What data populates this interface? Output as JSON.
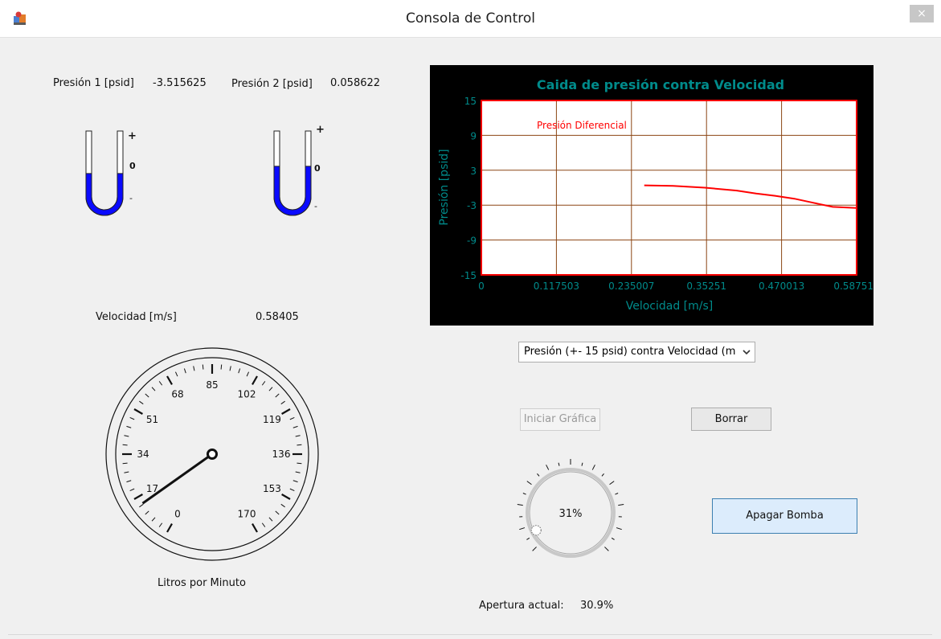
{
  "window": {
    "title": "Consola de Control",
    "close_label": "×"
  },
  "pressure1": {
    "label": "Presión 1 [psid]",
    "value": "-3.515625",
    "plus": "+",
    "zero": "0",
    "minus": "-",
    "level": -0.2344
  },
  "pressure2": {
    "label": "Presión 2 [psid]",
    "value": "0.058622",
    "plus": "+",
    "zero": "0",
    "minus": "-",
    "level": 0.0039
  },
  "velocity": {
    "label": "Velocidad [m/s]",
    "value": "0.58405"
  },
  "flow_gauge": {
    "caption": "Litros por Minuto",
    "scale_labels": [
      "0",
      "17",
      "34",
      "51",
      "68",
      "85",
      "102",
      "119",
      "136",
      "153",
      "170"
    ],
    "min": 0,
    "max": 170,
    "value": 14
  },
  "chart_data": {
    "type": "line",
    "title": "Caida de presión contra Velocidad",
    "xlabel": "Velocidad [m/s]",
    "ylabel": "Presión [psid]",
    "xlim": [
      0,
      0.587516
    ],
    "ylim": [
      -15,
      15
    ],
    "x_tick_labels": [
      "0",
      "0.117503",
      "0.235007",
      "0.35251",
      "0.470013",
      "0.587516"
    ],
    "y_tick_labels": [
      "15",
      "9",
      "3",
      "-3",
      "-9",
      "-15"
    ],
    "grid": true,
    "legend_position": "top-left",
    "series": [
      {
        "name": "Presión Diferencial",
        "color": "#ff0000",
        "x": [
          0.255,
          0.3,
          0.35,
          0.4,
          0.43,
          0.46,
          0.49,
          0.52,
          0.55,
          0.5875
        ],
        "y": [
          0.4,
          0.3,
          0.0,
          -0.5,
          -1.0,
          -1.4,
          -1.9,
          -2.6,
          -3.3,
          -3.5
        ]
      }
    ],
    "colors": {
      "background": "#000000",
      "plot_area": "#ffffff",
      "plot_border": "#ff0000",
      "grid": "#8b4513",
      "title": "#008b8b",
      "ticks": "#008b8b",
      "axis_label": "#008b8b"
    }
  },
  "dropdown": {
    "selected": "Presión (+- 15 psid) contra Velocidad (m",
    "arrow_icon": "chevron-down-icon"
  },
  "buttons": {
    "start_chart": "Iniciar Gráfica",
    "clear": "Borrar",
    "pump": "Apagar Bomba"
  },
  "valve_knob": {
    "value": 0.31,
    "value_label": "31%"
  },
  "aperture": {
    "label": "Apertura actual:",
    "value": "30.9%"
  }
}
